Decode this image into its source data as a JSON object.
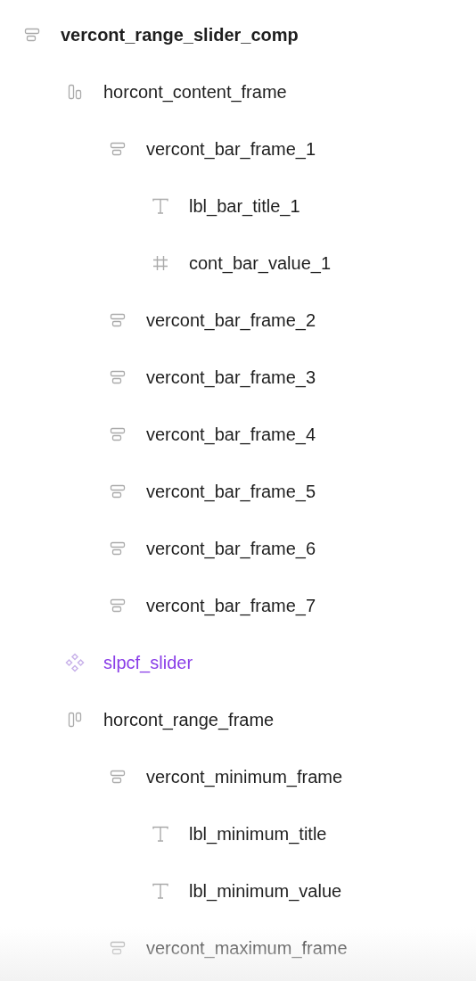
{
  "layers": [
    {
      "name": "vercont_range_slider_comp",
      "kind": "vstack",
      "children": [
        {
          "name": "horcont_content_frame",
          "kind": "hstack_bottom",
          "children": [
            {
              "name": "vercont_bar_frame_1",
              "kind": "vstack",
              "children": [
                {
                  "name": "lbl_bar_title_1",
                  "kind": "text"
                },
                {
                  "name": "cont_bar_value_1",
                  "kind": "frame"
                }
              ]
            },
            {
              "name": "vercont_bar_frame_2",
              "kind": "vstack"
            },
            {
              "name": "vercont_bar_frame_3",
              "kind": "vstack"
            },
            {
              "name": "vercont_bar_frame_4",
              "kind": "vstack"
            },
            {
              "name": "vercont_bar_frame_5",
              "kind": "vstack"
            },
            {
              "name": "vercont_bar_frame_6",
              "kind": "vstack"
            },
            {
              "name": "vercont_bar_frame_7",
              "kind": "vstack"
            }
          ]
        },
        {
          "name": "slpcf_slider",
          "kind": "component"
        },
        {
          "name": "horcont_range_frame",
          "kind": "hstack_top",
          "children": [
            {
              "name": "vercont_minimum_frame",
              "kind": "vstack",
              "children": [
                {
                  "name": "lbl_minimum_title",
                  "kind": "text"
                },
                {
                  "name": "lbl_minimum_value",
                  "kind": "text"
                }
              ]
            },
            {
              "name": "vercont_maximum_frame",
              "kind": "vstack"
            }
          ]
        }
      ]
    }
  ]
}
